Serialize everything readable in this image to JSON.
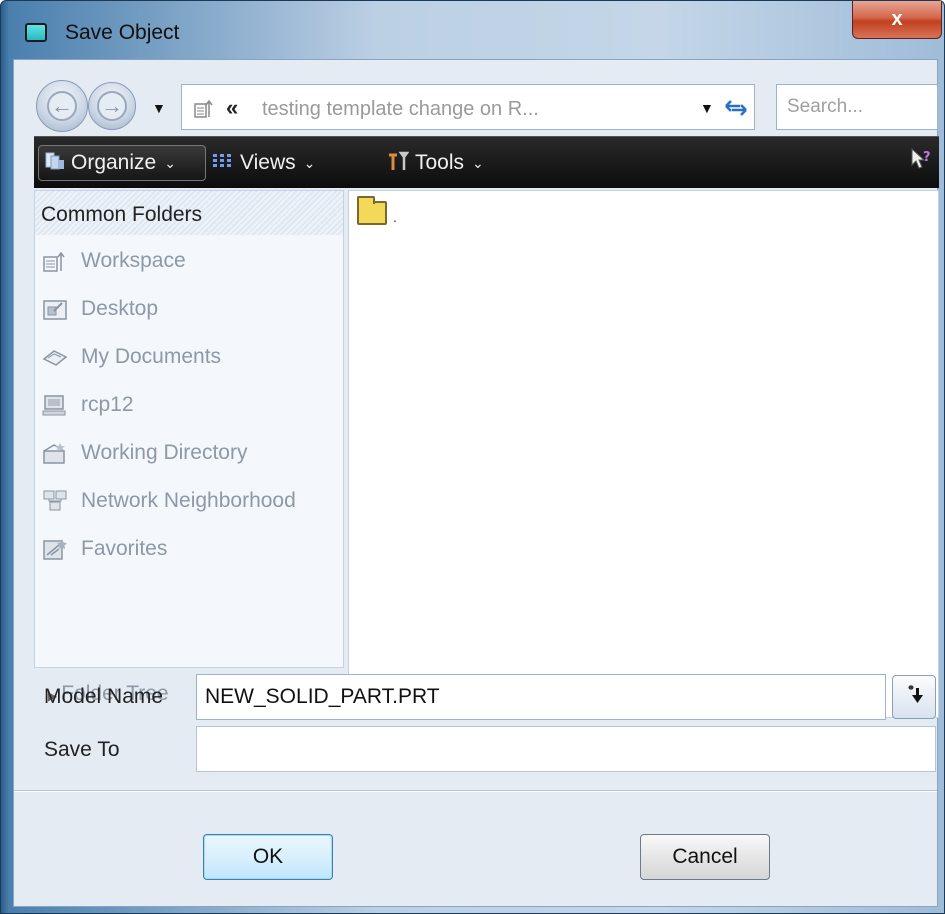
{
  "window": {
    "title": "Save Object",
    "close_label": "x"
  },
  "nav": {
    "back_glyph": "←",
    "forward_glyph": "→",
    "dropdown_glyph": "▼",
    "address": {
      "icon": "workspace-icon",
      "chevrons": "«",
      "path_text": "testing template change on R...",
      "dropdown_glyph": "▼",
      "refresh_icon": "refresh-icon"
    },
    "search": {
      "placeholder": "Search...",
      "value": ""
    }
  },
  "toolbar": {
    "organize_label": "Organize",
    "views_label": "Views",
    "tools_label": "Tools",
    "chevron": "⌄",
    "help_icon": "help-icon"
  },
  "common_folders": {
    "header": "Common Folders",
    "items": [
      {
        "label": "Workspace",
        "icon": "workspace-icon"
      },
      {
        "label": "Desktop",
        "icon": "desktop-icon"
      },
      {
        "label": "My Documents",
        "icon": "documents-icon"
      },
      {
        "label": "rcp12",
        "icon": "computer-icon"
      },
      {
        "label": "Working Directory",
        "icon": "working-directory-icon"
      },
      {
        "label": "Network Neighborhood",
        "icon": "network-icon"
      },
      {
        "label": "Favorites",
        "icon": "favorites-icon"
      }
    ]
  },
  "folder_tree": {
    "label": "Folder Tree"
  },
  "files": [
    {
      "name": ".",
      "icon": "folder-icon"
    }
  ],
  "form": {
    "model_name_label": "Model Name",
    "model_name_value": "NEW_SOLID_PART.PRT",
    "save_to_label": "Save To",
    "save_to_value": ""
  },
  "buttons": {
    "ok_label": "OK",
    "cancel_label": "Cancel"
  },
  "colors": {
    "toolbar_bg": "#111111",
    "client_bg": "#e4ebf3",
    "close_button": "#c2401e",
    "ok_border": "#3c7fb1"
  }
}
